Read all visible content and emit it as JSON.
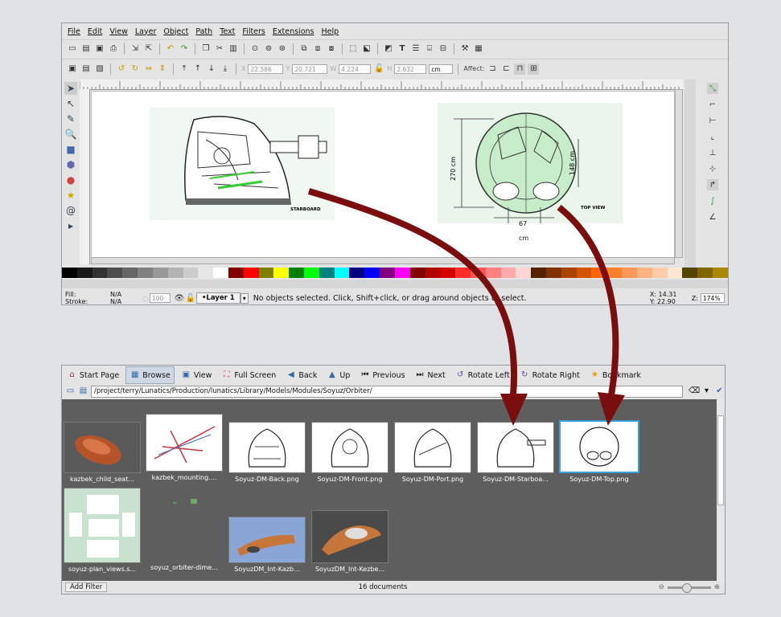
{
  "inkscape": {
    "menu": [
      "File",
      "Edit",
      "View",
      "Layer",
      "Object",
      "Path",
      "Text",
      "Filters",
      "Extensions",
      "Help"
    ],
    "controls": {
      "x": "22.586",
      "y": "20.721",
      "w": "4.224",
      "h": "2.632",
      "unit": "cm",
      "affect_label": "Affect:"
    },
    "canvas": {
      "left_label": "STARBOARD",
      "right_label": "TOP VIEW",
      "dim_height": "270 cm",
      "dim_width": "148 cm",
      "dim_bottom_value": "67",
      "dim_bottom_unit": "cm"
    },
    "status": {
      "fill_label": "Fill:",
      "fill_value": "N/A",
      "stroke_label": "Stroke:",
      "stroke_value": "N/A",
      "opacity": "100",
      "layer": "•Layer 1",
      "message": "No objects selected. Click, Shift+click, or drag around objects to select.",
      "x_label": "X:",
      "x_value": "14.31",
      "y_label": "Y:",
      "y_value": "22.90",
      "zoom_label": "Z:",
      "zoom_value": "174%"
    },
    "palette_colors": [
      "#000000",
      "#1a1a1a",
      "#333333",
      "#4d4d4d",
      "#666666",
      "#808080",
      "#999999",
      "#b3b3b3",
      "#cccccc",
      "#e6e6e6",
      "#ffffff",
      "#800000",
      "#ff0000",
      "#808000",
      "#ffff00",
      "#008000",
      "#00ff00",
      "#008080",
      "#00ffff",
      "#000080",
      "#0000ff",
      "#800080",
      "#ff00ff",
      "#7f0000",
      "#b20000",
      "#d40000",
      "#ff2a2a",
      "#ff5555",
      "#ff8080",
      "#ffaaaa",
      "#ffd5d5",
      "#552200",
      "#803300",
      "#aa4400",
      "#d45500",
      "#ff6600",
      "#ff7f2a",
      "#ff9955",
      "#ffb380",
      "#ffccaa",
      "#ffe6d5",
      "#554400",
      "#806600",
      "#aa8800"
    ]
  },
  "gwenview": {
    "toolbar": [
      "Start Page",
      "Browse",
      "View",
      "Full Screen",
      "Back",
      "Up",
      "Previous",
      "Next",
      "Rotate Left",
      "Rotate Right",
      "Bookmark"
    ],
    "path": "/project/terry/Lunatics/Production/lunatics/Library/Models/Modules/Soyuz/Orbiter/",
    "thumbnails": [
      {
        "caption": "kazbek_child_seat..."
      },
      {
        "caption": "kazbek_mounting...."
      },
      {
        "caption": "Soyuz-DM-Back.png"
      },
      {
        "caption": "Soyuz-DM-Front.png"
      },
      {
        "caption": "Soyuz-DM-Port.png"
      },
      {
        "caption": "Soyuz-DM-Starboa..."
      },
      {
        "caption": "Soyuz-DM-Top.png"
      },
      {
        "caption": "soyuz-plan_views.s..."
      },
      {
        "caption": "soyuz_orbiter-dime..."
      },
      {
        "caption": "SoyuzDM_Int-Kazb..."
      },
      {
        "caption": "SoyuzDM_Int-Kezbe..."
      }
    ],
    "status": {
      "add_filter": "Add Filter",
      "count": "16 documents"
    }
  },
  "colors": {
    "arrow": "#7a0d0d",
    "selected_border": "#3aa0e0",
    "browse_bg": "#5e5e5e"
  }
}
